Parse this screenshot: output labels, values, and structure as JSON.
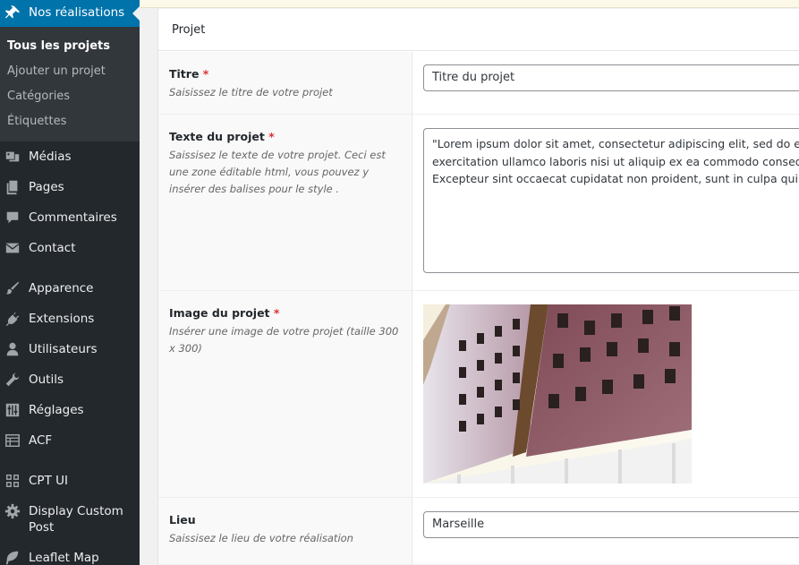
{
  "sidebar": {
    "active_menu": {
      "label": "Nos réalisations",
      "icon": "pin-icon"
    },
    "submenu": [
      {
        "label": "Tous les projets",
        "current": true
      },
      {
        "label": "Ajouter un projet"
      },
      {
        "label": "Catégories"
      },
      {
        "label": "Étiquettes"
      }
    ],
    "items": [
      {
        "label": "Médias",
        "icon": "media-icon"
      },
      {
        "label": "Pages",
        "icon": "pages-icon"
      },
      {
        "label": "Commentaires",
        "icon": "comments-icon"
      },
      {
        "label": "Contact",
        "icon": "mail-icon"
      },
      {
        "label": "Apparence",
        "icon": "brush-icon"
      },
      {
        "label": "Extensions",
        "icon": "plugin-icon"
      },
      {
        "label": "Utilisateurs",
        "icon": "user-icon"
      },
      {
        "label": "Outils",
        "icon": "wrench-icon"
      },
      {
        "label": "Réglages",
        "icon": "settings-sliders-icon"
      },
      {
        "label": "ACF",
        "icon": "acf-grid-icon"
      },
      {
        "label": "CPT UI",
        "icon": "cptui-icon"
      },
      {
        "label": "Display Custom Post",
        "icon": "gear-icon"
      },
      {
        "label": "Leaflet Map",
        "icon": "leaf-icon"
      }
    ]
  },
  "metabox": {
    "title": "Projet",
    "fields": [
      {
        "label": "Titre",
        "required": "*",
        "description": "Saisissez le titre de votre projet",
        "value": "Titre du projet"
      },
      {
        "label": "Texte du projet",
        "required": "*",
        "description": "Saissisez le texte de votre projet. Ceci est une zone éditable html, vous pouvez y insérer des balises pour le style .",
        "value": "\"Lorem ipsum dolor sit amet, consectetur adipiscing elit, sed do eiusmod tempor incididunt ut labore et dolore magna aliqua. Ut enim ad minim veniam, quis nostrud\nexercitation ullamco laboris nisi ut aliquip ex ea commodo consequat. Duis aute irure dolor in reprehenderit in voluptate velit esse cillum dolore eu fugiat nulla pariatur.\nExcepteur sint occaecat cupidatat non proident, sunt in culpa qui officia deserunt mollit anim id est laborum.\""
      },
      {
        "label": "Image du projet",
        "required": "*",
        "description": "Insérer une image de votre projet (taille 300 x 300)"
      },
      {
        "label": "Lieu",
        "description": "Saissisez le lieu de votre réalisation",
        "value": "Marseille"
      }
    ]
  },
  "colors": {
    "sidebar_bg": "#23282d",
    "submenu_bg": "#32373c",
    "active_bg": "#0073aa",
    "required": "#dc3232"
  }
}
